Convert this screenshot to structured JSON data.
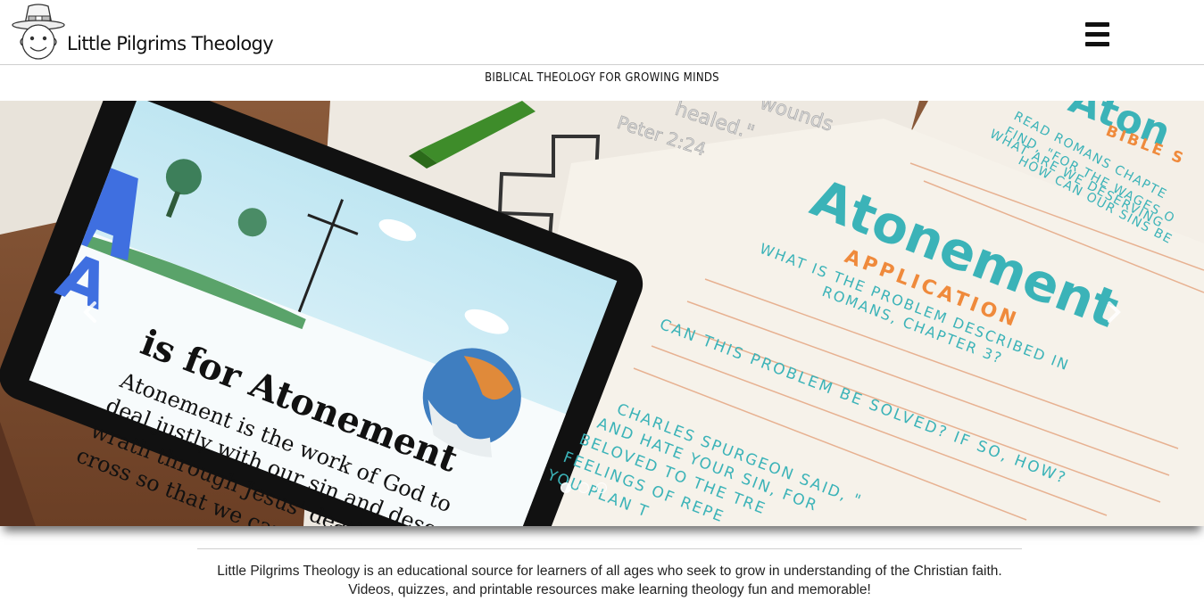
{
  "site": {
    "name": "Little Pilgrims Theology",
    "tagline": "BIBLICAL THEOLOGY FOR GROWING MINDS",
    "menu_icon": "hamburger-icon"
  },
  "hero": {
    "slide_count": 3,
    "active_slide": 1,
    "tablet": {
      "letter": "A",
      "heading": "is for Atonement",
      "lines": [
        "Atonement is the work of God to",
        "deal justly with our sin and deserved",
        "wrath through Jesus' death on the",
        "cross so that we can have eternal life."
      ]
    },
    "worksheet": {
      "title": "Atonement",
      "subtitle": "APPLICATION",
      "question1": [
        "WHAT IS THE PROBLEM DESCRIBED IN",
        "ROMANS, CHAPTER 3?"
      ],
      "question2": "CAN THIS PROBLEM BE SOLVED? IF SO, HOW?",
      "quote": [
        "CHARLES SPURGEON SAID, \"",
        "AND HATE YOUR SIN, FOR",
        "BELOVED TO THE TRE",
        "FEELINGS OF REPE",
        "YOU PLAN T"
      ]
    },
    "bible_sheet": {
      "title": "Aton",
      "subtitle": "BIBLE S",
      "lines": [
        "READ ROMANS CHAPTE",
        "FIND, \"FOR THE WAGES O",
        "WHAT ARE WE DESERVING",
        "HOW CAN OUR SINS BE"
      ]
    },
    "verse_sheet": {
      "lines": [
        "healed.\"",
        "wounds",
        "Peter 2:24"
      ]
    },
    "prev_icon": "chevron-left-icon",
    "next_icon": "chevron-right-icon",
    "colors": {
      "teal": "#3bb3b8",
      "orange": "#ef8a3c",
      "tablet_blue": "#4a78d9"
    }
  },
  "intro": {
    "line1": "Little Pilgrims Theology is an educational source for learners of all ages who seek to grow in understanding of the Christian faith.",
    "line2": "Videos, quizzes, and printable resources make learning theology fun and memorable!"
  }
}
